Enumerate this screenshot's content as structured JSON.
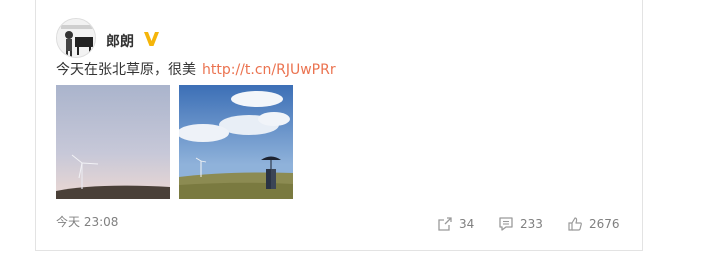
{
  "post": {
    "username": "郎朗",
    "verified_badge": "v-verified-icon",
    "text": "今天在张北草原，很美",
    "link": "http://t.cn/RJUwPRr",
    "timestamp": "今天 23:08"
  },
  "actions": {
    "repost_count": "34",
    "comment_count": "233",
    "like_count": "2676"
  },
  "colors": {
    "link": "#eb7350",
    "verified": "#f5b50a",
    "meta": "#808080"
  }
}
